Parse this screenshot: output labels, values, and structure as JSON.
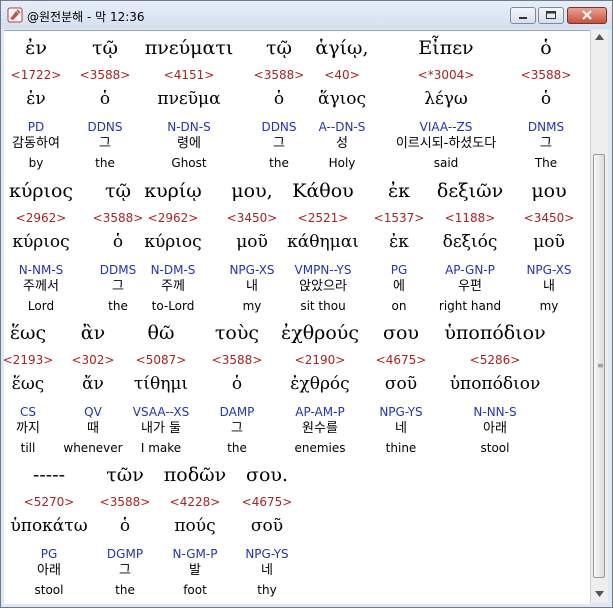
{
  "window": {
    "title": "@원전분해 - 막 12:36"
  },
  "rows": [
    [
      {
        "greek": "ἐν",
        "strong": "<1722>",
        "lemma": "ἐν",
        "parse": "PD",
        "kor": "감동하여",
        "eng": "by"
      },
      {
        "greek": "τῷ",
        "strong": "<3588>",
        "lemma": "ὁ",
        "parse": "DDNS",
        "kor": "그",
        "eng": "the"
      },
      {
        "greek": "πνεύματι",
        "strong": "<4151>",
        "lemma": "πνεῦμα",
        "parse": "N-DN-S",
        "kor": "령에",
        "eng": "Ghost"
      },
      {
        "greek": "τῷ",
        "strong": "<3588>",
        "lemma": "ὁ",
        "parse": "DDNS",
        "kor": "그",
        "eng": "the"
      },
      {
        "greek": "ἁγίῳ,",
        "strong": "<40>",
        "lemma": "ἅγιος",
        "parse": "A--DN-S",
        "kor": "성",
        "eng": "Holy"
      },
      {
        "greek": "Εἶπεν",
        "strong": "<*3004>",
        "lemma": "λέγω",
        "parse": "VIAA--ZS",
        "kor": "이르시되-하셨도다",
        "eng": "said"
      },
      {
        "greek": "ὁ",
        "strong": "<3588>",
        "lemma": "ὁ",
        "parse": "DNMS",
        "kor": "그",
        "eng": "The"
      }
    ],
    [
      {
        "greek": "κύριος",
        "strong": "<2962>",
        "lemma": "κύριος",
        "parse": "N-NM-S",
        "kor": "주께서",
        "eng": "Lord"
      },
      {
        "greek": "τῷ",
        "strong": "<3588>",
        "lemma": "ὁ",
        "parse": "DDMS",
        "kor": "그",
        "eng": "the"
      },
      {
        "greek": "κυρίῳ",
        "strong": "<2962>",
        "lemma": "κύριος",
        "parse": "N-DM-S",
        "kor": "주께",
        "eng": "to-Lord"
      },
      {
        "greek": "μου,",
        "strong": "<3450>",
        "lemma": "μοῦ",
        "parse": "NPG-XS",
        "kor": "내",
        "eng": "my"
      },
      {
        "greek": "Κάθου",
        "strong": "<2521>",
        "lemma": "κάθημαι",
        "parse": "VMPN--YS",
        "kor": "앉았으라",
        "eng": "sit thou"
      },
      {
        "greek": "ἐκ",
        "strong": "<1537>",
        "lemma": "ἐκ",
        "parse": "PG",
        "kor": "에",
        "eng": "on"
      },
      {
        "greek": "δεξιῶν",
        "strong": "<1188>",
        "lemma": "δεξιός",
        "parse": "AP-GN-P",
        "kor": "우편",
        "eng": "right hand"
      },
      {
        "greek": "μου",
        "strong": "<3450>",
        "lemma": "μοῦ",
        "parse": "NPG-XS",
        "kor": "내",
        "eng": "my"
      }
    ],
    [
      {
        "greek": "ἕως",
        "strong": "<2193>",
        "lemma": "ἕως",
        "parse": "CS",
        "kor": "까지",
        "eng": "till"
      },
      {
        "greek": "ἂν",
        "strong": "<302>",
        "lemma": "ἄν",
        "parse": "QV",
        "kor": "때",
        "eng": "whenever"
      },
      {
        "greek": "θῶ",
        "strong": "<5087>",
        "lemma": "τίθημι",
        "parse": "VSAA--XS",
        "kor": "내가 둘",
        "eng": "I make"
      },
      {
        "greek": "τοὺς",
        "strong": "<3588>",
        "lemma": "ὁ",
        "parse": "DAMP",
        "kor": "그",
        "eng": "the"
      },
      {
        "greek": "ἐχθρούς",
        "strong": "<2190>",
        "lemma": "ἐχθρός",
        "parse": "AP-AM-P",
        "kor": "원수를",
        "eng": "enemies"
      },
      {
        "greek": "σου",
        "strong": "<4675>",
        "lemma": "σοῦ",
        "parse": "NPG-YS",
        "kor": "네",
        "eng": "thine"
      },
      {
        "greek": "ὑποπόδιον",
        "strong": "<5286>",
        "lemma": "ὑποπόδιον",
        "parse": "N-NN-S",
        "kor": "아래",
        "eng": "stool"
      }
    ],
    [
      {
        "greek": "-----",
        "strong": "<5270>",
        "lemma": "ὑποκάτω",
        "parse": "PG",
        "kor": "아래",
        "eng": "stool"
      },
      {
        "greek": "τῶν",
        "strong": "<3588>",
        "lemma": "ὁ",
        "parse": "DGMP",
        "kor": "그",
        "eng": "the"
      },
      {
        "greek": "ποδῶν",
        "strong": "<4228>",
        "lemma": "πούς",
        "parse": "N-GM-P",
        "kor": "발",
        "eng": "foot"
      },
      {
        "greek": "σου.",
        "strong": "<4675>",
        "lemma": "σοῦ",
        "parse": "NPG-YS",
        "kor": "네",
        "eng": "thy"
      }
    ]
  ]
}
